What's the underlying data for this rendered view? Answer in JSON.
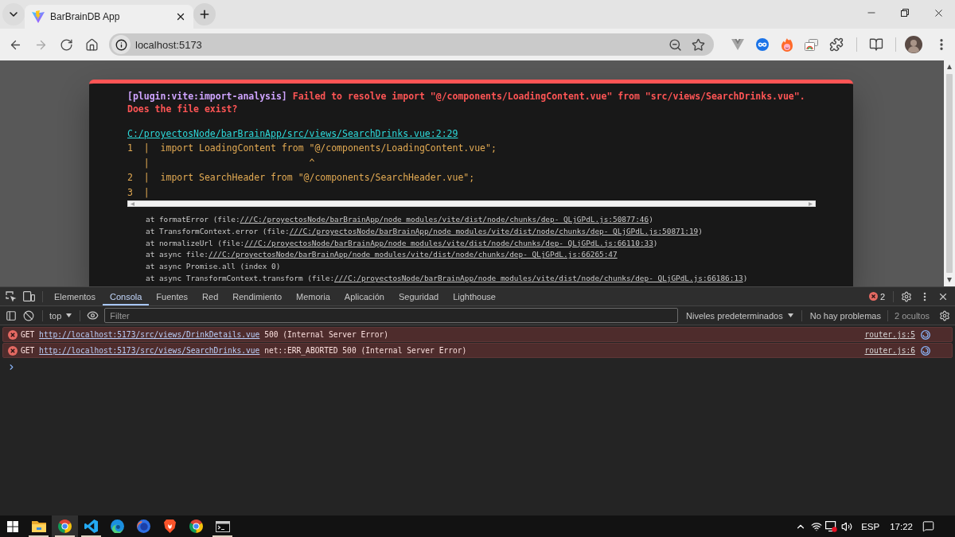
{
  "browser": {
    "tabs": [
      {
        "title": "BarBrainDB App",
        "selected": true
      }
    ],
    "nav_buttons": [
      {
        "kind": "back",
        "disabled": false
      },
      {
        "kind": "forward",
        "disabled": true
      },
      {
        "kind": "reload",
        "disabled": false
      },
      {
        "kind": "home",
        "disabled": false
      }
    ],
    "address_bar": {
      "url": "localhost:5173"
    }
  },
  "error_overlay": {
    "plugin": "[plugin:vite:import-analysis]",
    "message": "Failed to resolve import \"@/components/LoadingContent.vue\" from \"src/views/SearchDrinks.vue\". Does the file exist?",
    "file": "C:/proyectosNode/barBrainApp/src/views/SearchDrinks.vue:2:29",
    "code_frame": [
      "1  |  import LoadingContent from \"@/components/LoadingContent.vue\";",
      "   |                             ^",
      "2  |  import SearchHeader from \"@/components/SearchHeader.vue\";",
      "3  |"
    ],
    "stack": [
      {
        "text": "at formatError (file:",
        "link": "///C:/proyectosNode/barBrainApp/node_modules/vite/dist/node/chunks/dep-_QLjGPdL.js:50877:46",
        "suffix": ")"
      },
      {
        "text": "at TransformContext.error (file:",
        "link": "///C:/proyectosNode/barBrainApp/node_modules/vite/dist/node/chunks/dep-_QLjGPdL.js:50871:19",
        "suffix": ")"
      },
      {
        "text": "at normalizeUrl (file:",
        "link": "///C:/proyectosNode/barBrainApp/node_modules/vite/dist/node/chunks/dep-_QLjGPdL.js:66110:33",
        "suffix": ")"
      },
      {
        "text": "at async file:",
        "link": "///C:/proyectosNode/barBrainApp/node_modules/vite/dist/node/chunks/dep-_QLjGPdL.js:66265:47"
      },
      {
        "text": "at async Promise.all (index 0)"
      },
      {
        "text": "at async TransformContext.transform (file:",
        "link": "///C:/proyectosNode/barBrainApp/node_modules/vite/dist/node/chunks/dep-_QLjGPdL.js:66186:13",
        "suffix": ")"
      }
    ]
  },
  "devtools": {
    "tabs": [
      {
        "label": "Elementos",
        "selected": false
      },
      {
        "label": "Consola",
        "selected": true
      },
      {
        "label": "Fuentes",
        "selected": false
      },
      {
        "label": "Red",
        "selected": false
      },
      {
        "label": "Rendimiento",
        "selected": false
      },
      {
        "label": "Memoria",
        "selected": false
      },
      {
        "label": "Aplicación",
        "selected": false
      },
      {
        "label": "Seguridad",
        "selected": false
      },
      {
        "label": "Lighthouse",
        "selected": false
      }
    ],
    "error_count": "2",
    "context": "top",
    "filter": {
      "placeholder": "Filter"
    },
    "log_levels": "Niveles predeterminados",
    "issues": "No hay problemas",
    "hidden": "2 ocultos",
    "messages": [
      {
        "method": "GET",
        "url": "http://localhost:5173/src/views/DrinkDetails.vue",
        "detail": "500 (Internal Server Error)",
        "source": "router.js:5"
      },
      {
        "method": "GET",
        "url": "http://localhost:5173/src/views/SearchDrinks.vue",
        "detail": "net::ERR_ABORTED 500 (Internal Server Error)",
        "source": "router.js:6"
      }
    ]
  },
  "taskbar": {
    "apps": [
      {
        "kind": "explorer",
        "running": true,
        "selected": false
      },
      {
        "kind": "chrome",
        "running": true,
        "selected": true
      },
      {
        "kind": "vscode",
        "running": true,
        "selected": false
      },
      {
        "kind": "edge",
        "running": false,
        "selected": false
      },
      {
        "kind": "firefox",
        "running": false,
        "selected": false
      },
      {
        "kind": "brave",
        "running": false,
        "selected": false
      },
      {
        "kind": "chrome",
        "running": false,
        "selected": false
      },
      {
        "kind": "terminal",
        "running": true,
        "selected": false
      }
    ],
    "language": "ESP",
    "time": "17:22"
  }
}
